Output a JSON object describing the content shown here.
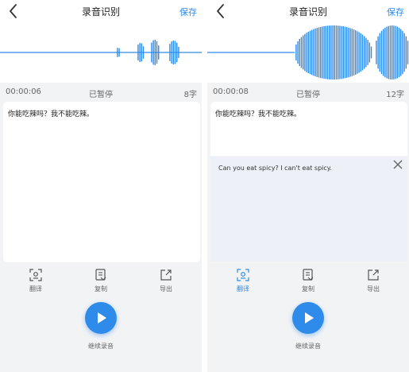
{
  "accent_color": "#2f8be9",
  "left": {
    "title": "录音识别",
    "save_label": "保存",
    "time": "00:00:06",
    "status": "已暂停",
    "char_count": "8字",
    "transcript": "你能吃辣吗？我不能吃辣。",
    "tools": [
      {
        "label": "翻译",
        "icon": "translate-icon",
        "active": false
      },
      {
        "label": "复制",
        "icon": "copy-icon",
        "active": false
      },
      {
        "label": "导出",
        "icon": "export-icon",
        "active": false
      }
    ],
    "play_label": "继续录音"
  },
  "right": {
    "title": "录音识别",
    "save_label": "保存",
    "time": "00:00:08",
    "status": "已暂停",
    "char_count": "12字",
    "transcript": "你能吃辣吗？我不能吃辣。",
    "translation": "Can you eat spicy? I can't eat spicy.",
    "tools": [
      {
        "label": "翻译",
        "icon": "translate-icon",
        "active": true
      },
      {
        "label": "复制",
        "icon": "copy-icon",
        "active": false
      },
      {
        "label": "导出",
        "icon": "export-icon",
        "active": false
      }
    ],
    "play_label": "继续录音"
  }
}
